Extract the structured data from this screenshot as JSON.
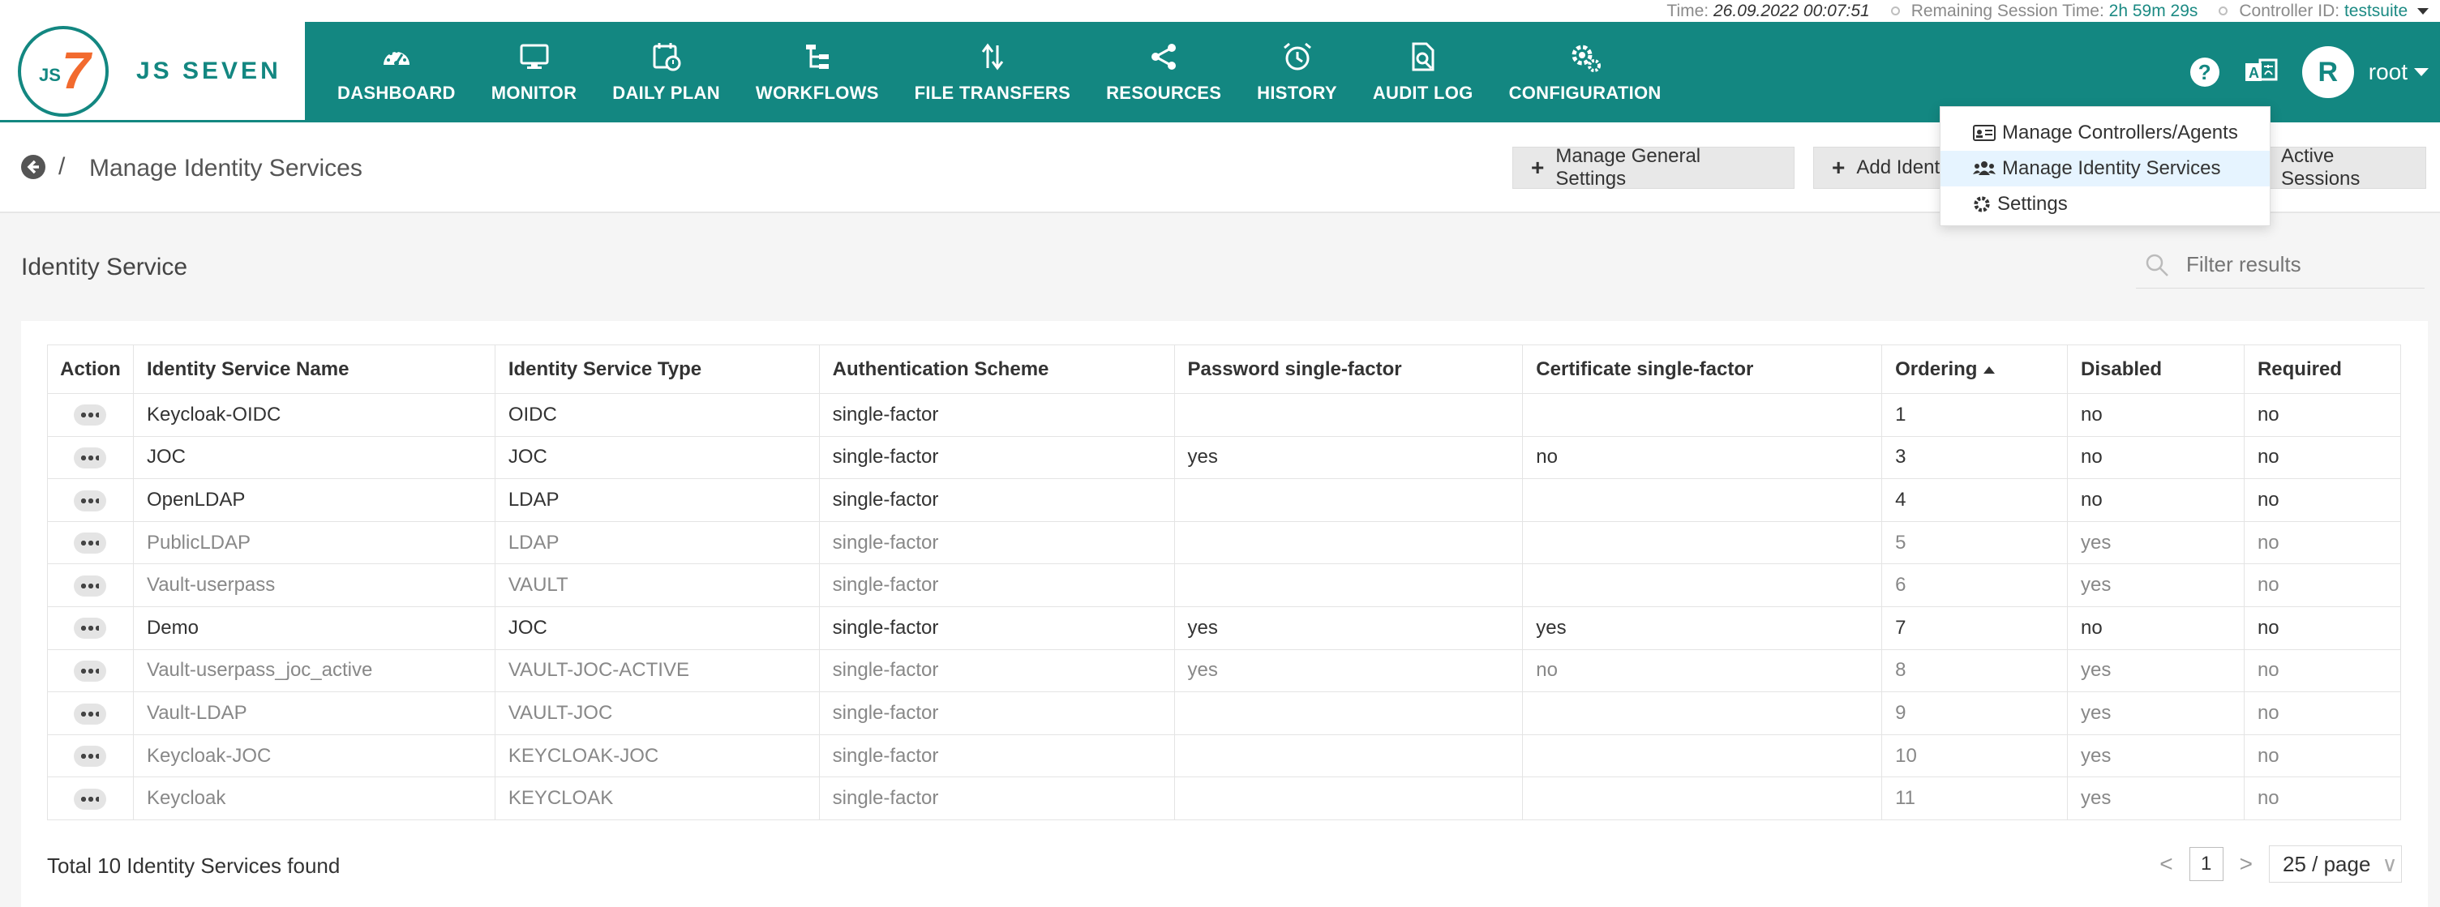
{
  "status_bar": {
    "time_label": "Time:",
    "time_value": "26.09.2022 00:07:51",
    "session_label": "Remaining Session Time:",
    "session_value": "2h 59m 29s",
    "controller_label": "Controller ID:",
    "controller_value": "testsuite"
  },
  "brand": {
    "logo_js": "JS",
    "logo_seven": "7",
    "name": "JS SEVEN"
  },
  "nav": [
    {
      "label": "DASHBOARD",
      "icon": "dashboard-icon"
    },
    {
      "label": "MONITOR",
      "icon": "monitor-icon"
    },
    {
      "label": "DAILY PLAN",
      "icon": "calendar-clock-icon"
    },
    {
      "label": "WORKFLOWS",
      "icon": "workflow-icon"
    },
    {
      "label": "FILE TRANSFERS",
      "icon": "transfer-arrows-icon"
    },
    {
      "label": "RESOURCES",
      "icon": "share-nodes-icon"
    },
    {
      "label": "HISTORY",
      "icon": "alarm-clock-icon"
    },
    {
      "label": "AUDIT LOG",
      "icon": "file-search-icon"
    },
    {
      "label": "CONFIGURATION",
      "icon": "gears-icon"
    }
  ],
  "header_right": {
    "help": "?",
    "avatar_initial": "R",
    "user": "root"
  },
  "title_bar": {
    "separator": "/",
    "title": "Manage Identity Services",
    "btn_general_settings": "Manage General Settings",
    "btn_add": "Add Identity Service",
    "btn_sessions": "Active Sessions"
  },
  "dropdown": [
    {
      "label": "Manage Controllers/Agents",
      "icon": "id-card-icon"
    },
    {
      "label": "Manage Identity Services",
      "icon": "users-icon",
      "active": true
    },
    {
      "label": "Settings",
      "icon": "gear-icon"
    }
  ],
  "section": {
    "title": "Identity Service",
    "filter_placeholder": "Filter results"
  },
  "table": {
    "headers": [
      "Action",
      "Identity Service Name",
      "Identity Service Type",
      "Authentication Scheme",
      "Password single-factor",
      "Certificate single-factor",
      "Ordering",
      "Disabled",
      "Required"
    ],
    "rows": [
      {
        "name": "Keycloak-OIDC",
        "type": "OIDC",
        "scheme": "single-factor",
        "password": "",
        "certificate": "",
        "ordering": "1",
        "disabled": "no",
        "required": "no"
      },
      {
        "name": "JOC",
        "type": "JOC",
        "scheme": "single-factor",
        "password": "yes",
        "certificate": "no",
        "ordering": "3",
        "disabled": "no",
        "required": "no"
      },
      {
        "name": "OpenLDAP",
        "type": "LDAP",
        "scheme": "single-factor",
        "password": "",
        "certificate": "",
        "ordering": "4",
        "disabled": "no",
        "required": "no"
      },
      {
        "name": "PublicLDAP",
        "type": "LDAP",
        "scheme": "single-factor",
        "password": "",
        "certificate": "",
        "ordering": "5",
        "disabled": "yes",
        "required": "no"
      },
      {
        "name": "Vault-userpass",
        "type": "VAULT",
        "scheme": "single-factor",
        "password": "",
        "certificate": "",
        "ordering": "6",
        "disabled": "yes",
        "required": "no"
      },
      {
        "name": "Demo",
        "type": "JOC",
        "scheme": "single-factor",
        "password": "yes",
        "certificate": "yes",
        "ordering": "7",
        "disabled": "no",
        "required": "no"
      },
      {
        "name": "Vault-userpass_joc_active",
        "type": "VAULT-JOC-ACTIVE",
        "scheme": "single-factor",
        "password": "yes",
        "certificate": "no",
        "ordering": "8",
        "disabled": "yes",
        "required": "no"
      },
      {
        "name": "Vault-LDAP",
        "type": "VAULT-JOC",
        "scheme": "single-factor",
        "password": "",
        "certificate": "",
        "ordering": "9",
        "disabled": "yes",
        "required": "no"
      },
      {
        "name": "Keycloak-JOC",
        "type": "KEYCLOAK-JOC",
        "scheme": "single-factor",
        "password": "",
        "certificate": "",
        "ordering": "10",
        "disabled": "yes",
        "required": "no"
      },
      {
        "name": "Keycloak",
        "type": "KEYCLOAK",
        "scheme": "single-factor",
        "password": "",
        "certificate": "",
        "ordering": "11",
        "disabled": "yes",
        "required": "no"
      }
    ]
  },
  "footer": {
    "total": "Total 10 Identity Services found",
    "prev": "<",
    "page": "1",
    "next": ">",
    "page_size": "25 / page",
    "page_size_chevron": "∨"
  },
  "colors": {
    "brand": "#138781",
    "accent_orange": "#f26a2e",
    "dropdown_active": "#e6f4ff"
  }
}
